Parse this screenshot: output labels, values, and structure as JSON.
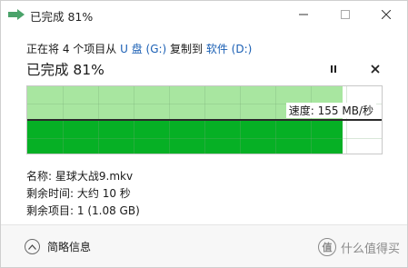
{
  "window": {
    "title": "已完成 81%",
    "buttons": {
      "minimize": "minimize-icon",
      "maximize": "maximize-icon",
      "close": "close-icon"
    }
  },
  "copy": {
    "prefix": "正在将 4 个项目从 ",
    "source": "U 盘 (G:)",
    "middle": " 复制到 ",
    "destination": "软件 (D:)"
  },
  "status": {
    "percent_text": "已完成 81%",
    "progress": 0.81
  },
  "graph": {
    "speed_label": "速度: 155 MB/秒",
    "colors": {
      "light": "#a8e6a0",
      "dark": "#06b025"
    }
  },
  "details": {
    "name_label": "名称:",
    "name_value": "星球大战9.mkv",
    "time_label": "剩余时间:",
    "time_value": "大约 10 秒",
    "items_label": "剩余项目:",
    "items_value": "1 (1.08 GB)"
  },
  "footer": {
    "collapse_label": "简略信息",
    "watermark_logo": "值",
    "watermark_text": "什么值得买"
  }
}
